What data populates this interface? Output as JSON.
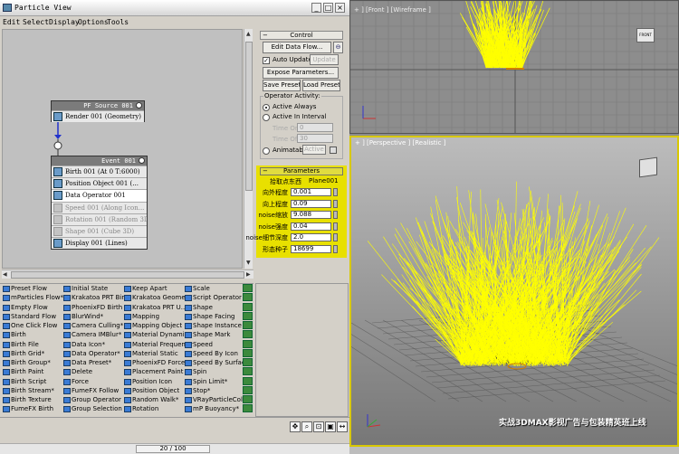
{
  "window": {
    "title": "Particle View"
  },
  "menu": [
    "Edit",
    "Select",
    "Display",
    "Options",
    "Tools"
  ],
  "source_event": {
    "title": "PF Source 001",
    "operators": [
      {
        "label": "Render 001 (Geometry)",
        "state": "normal"
      }
    ]
  },
  "event": {
    "title": "Event 001",
    "operators": [
      {
        "label": "Birth 001 (At 0 T:6000)",
        "state": "normal"
      },
      {
        "label": "Position Object 001 (...",
        "state": "normal"
      },
      {
        "label": "Data Operator 001",
        "state": "selected"
      },
      {
        "label": "Speed 001 (Along Icon...",
        "state": "disabled"
      },
      {
        "label": "Rotation 001 (Random 3D)",
        "state": "disabled"
      },
      {
        "label": "Shape 001 (Cube 3D)",
        "state": "disabled"
      },
      {
        "label": "Display 001 (Lines)",
        "state": "normal"
      }
    ]
  },
  "control": {
    "header": "Control",
    "edit_data_flow": "Edit Data Flow...",
    "auto_update": "Auto Update",
    "update": "Update",
    "expose_parameters": "Expose Parameters...",
    "save_preset": "Save Preset",
    "load_preset": "Load Preset",
    "operator_activity": "Operator Activity:",
    "active_always": "Active Always",
    "active_in_interval": "Active In Interval",
    "time_on_label": "Time On:",
    "time_on_value": "0",
    "time_off_label": "Time Off:",
    "time_off_value": "30",
    "animatable": "Animatable",
    "active": "Active"
  },
  "parameters": {
    "header": "Parameters",
    "pick_label": "拾取点东西",
    "pick_value": "Plane001",
    "rows": [
      {
        "label": "向外程度",
        "value": "0.001"
      },
      {
        "label": "向上程度",
        "value": "0.09"
      },
      {
        "label": "noise缩放",
        "value": "9.088"
      },
      {
        "label": "noise强度",
        "value": "0.04"
      },
      {
        "label": "noise细节深度",
        "value": "2.0"
      },
      {
        "label": "形态种子",
        "value": "18699"
      }
    ]
  },
  "depot": {
    "col1": [
      "Preset Flow",
      "mParticles Flow*",
      "Empty Flow",
      "Standard Flow",
      "One Click Flow",
      "Birth",
      "Birth File",
      "Birth Grid*",
      "Birth Group*",
      "Birth Paint",
      "Birth Script",
      "Birth Stream*",
      "Birth Texture",
      "FumeFX Birth"
    ],
    "col2": [
      "Initial State",
      "Krakatoa PRT Bir...",
      "PhoenixFD Birth",
      "BlurWind*",
      "Camera Culling*",
      "Camera IMBlur*",
      "Data Icon*",
      "Data Operator*",
      "Data Preset*",
      "Delete",
      "Force",
      "FumeFX Follow",
      "Group Operator",
      "Group Selection"
    ],
    "col3": [
      "Keep Apart",
      "Krakatoa Geome...",
      "Krakatoa PRT U...",
      "Mapping",
      "Mapping Object",
      "Material Dynamic",
      "Material Frequency",
      "Material Static",
      "PhoenixFD Force",
      "Placement Paint",
      "Position Icon",
      "Position Object",
      "Random Walk*",
      "Rotation"
    ],
    "col4": [
      "Scale",
      "Script Operator",
      "Shape",
      "Shape Facing",
      "Shape Instance",
      "Shape Mark",
      "Speed",
      "Speed By Icon",
      "Speed By Surface",
      "Spin",
      "Spin Limit*",
      "Stop*",
      "VRayParticleColor",
      "mP Buoyancy*"
    ]
  },
  "bottom": {
    "page": "20 / 100"
  },
  "viewports": {
    "top_label": "+ ] [Front ] [Wireframe ]",
    "bottom_label": "+ ] [Perspective ] [Realistic ]",
    "watermark": "实战3DMAX影视广告与包装精英班上线",
    "viewcube_top": "FRONT"
  },
  "colors": {
    "particles": "#ffff00",
    "params_bg": "#e8e000",
    "ui_grey": "#d4d0c8"
  }
}
